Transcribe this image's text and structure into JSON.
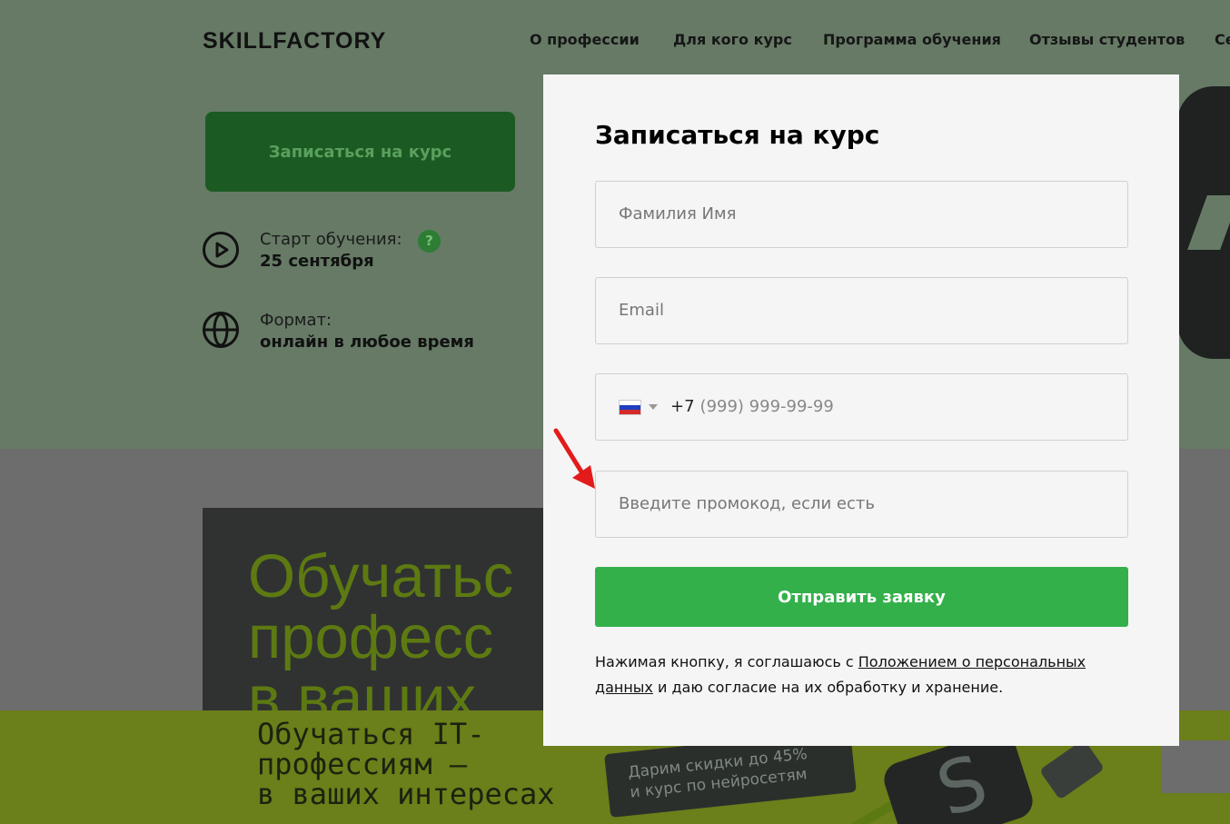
{
  "header": {
    "logo": "SKILLFACTORY",
    "nav": [
      "О профессии",
      "Для кого курс",
      "Программа обучения",
      "Отзывы студентов",
      "Се"
    ]
  },
  "hero": {
    "enroll_button": "Записаться на курс",
    "start_label": "Старт обучения:",
    "start_value": "25 сентября",
    "help_badge": "?",
    "format_label": "Формат:",
    "format_value": "онлайн в любое время"
  },
  "promo": {
    "big_line1": "Обучатьс",
    "big_line2": "професс",
    "big_line3": "в ваших",
    "band_line1": "Обучаться IT-",
    "band_line2": "профессиям —",
    "band_line3": "в ваших интересах",
    "tag_line1": "Дарим скидки до 45%",
    "tag_line2": "и курс по нейросетям",
    "device_letter": "S"
  },
  "modal": {
    "title": "Записаться на курс",
    "name_placeholder": "Фамилия Имя",
    "email_placeholder": "Email",
    "phone_prefix": "+7",
    "phone_mask": "(999) 999-99-99",
    "promo_placeholder": "Введите промокод, если есть",
    "submit_label": "Отправить заявку",
    "consent_before": "Нажимая кнопку, я соглашаюсь с ",
    "consent_link": "Положением о персональных данных",
    "consent_after": " и даю согласие на их обработку и хранение."
  },
  "colors": {
    "accent_green": "#34b04b",
    "arrow_red": "#e31b1b",
    "flag": [
      "#ffffff",
      "#1f3fbf",
      "#d42a2a"
    ]
  },
  "icons": [
    "play-circle-icon",
    "globe-icon",
    "question-icon",
    "flag-ru-icon",
    "chevron-down-icon",
    "red-arrow-icon"
  ]
}
